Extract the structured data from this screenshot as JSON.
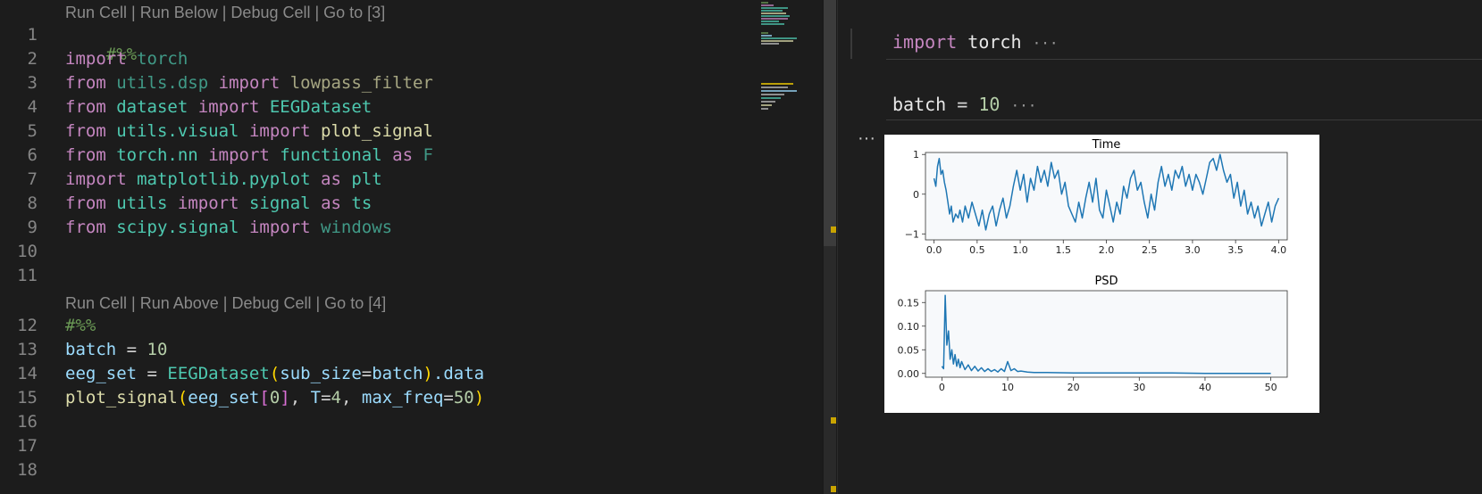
{
  "editor": {
    "lens_cell1": "Run Cell | Run Below | Debug Cell | Go to [3]",
    "lens_cell2": "Run Cell | Run Above | Debug Cell | Go to [4]",
    "line_numbers": [
      "1",
      "2",
      "3",
      "4",
      "5",
      "6",
      "7",
      "8",
      "9",
      "10",
      "11",
      "12",
      "13",
      "14",
      "15",
      "16",
      "17",
      "18"
    ],
    "tok": {
      "l1_marker": "#%%",
      "l2_import": "import",
      "l2_mod": "torch",
      "l3_from": "from",
      "l3_mod": "utils.dsp",
      "l3_import": "import",
      "l3_name": "lowpass_filter",
      "l4_from": "from",
      "l4_mod": "dataset",
      "l4_import": "import",
      "l4_name": "EEGDataset",
      "l5_from": "from",
      "l5_mod": "utils.visual",
      "l5_import": "import",
      "l5_name": "plot_signal",
      "l6_from": "from",
      "l6_mod": "torch.nn",
      "l6_import": "import",
      "l6_name": "functional",
      "l6_as": "as",
      "l6_alias": "F",
      "l7_import": "import",
      "l7_mod": "matplotlib.pyplot",
      "l7_as": "as",
      "l7_alias": "plt",
      "l8_from": "from",
      "l8_mod": "utils",
      "l8_import": "import",
      "l8_name": "signal",
      "l8_as": "as",
      "l8_alias": "ts",
      "l9_from": "from",
      "l9_mod": "scipy.signal",
      "l9_import": "import",
      "l9_name": "windows",
      "l12_marker": "#%%",
      "l13_var": "batch",
      "l13_eq": " = ",
      "l13_num": "10",
      "l14_var": "eeg_set",
      "l14_eq": " = ",
      "l14_cls": "EEGDataset",
      "l14_p": "(",
      "l14_arg": "sub_size",
      "l14_eq2": "=",
      "l14_arg2": "batch",
      "l14_p2": ")",
      "l14_attr": ".data",
      "l15_fn": "plot_signal",
      "l15_p": "(",
      "l15_a": "eeg_set",
      "l15_b": "[",
      "l15_idx": "0",
      "l15_b2": "]",
      "l15_c": ", ",
      "l15_T": "T",
      "l15_eq": "=",
      "l15_Tv": "4",
      "l15_c2": ", ",
      "l15_mf": "max_freq",
      "l15_eq2": "=",
      "l15_mfv": "50",
      "l15_p2": ")"
    }
  },
  "interactive": {
    "cell1_kw": "import",
    "cell1_mod": "torch",
    "cell2_var": "batch",
    "cell2_eq": " = ",
    "cell2_num": "10",
    "collapse_ellipsis": "···",
    "output_more": "···"
  },
  "chart_data": [
    {
      "type": "line",
      "title": "Time",
      "xlabel": "",
      "ylabel": "",
      "xlim": [
        -0.1,
        4.1
      ],
      "ylim": [
        -1.15,
        1.05
      ],
      "xticks": [
        "0.0",
        "0.5",
        "1.0",
        "1.5",
        "2.0",
        "2.5",
        "3.0",
        "3.5",
        "4.0"
      ],
      "yticks": [
        "1",
        "0",
        "−1"
      ],
      "color": "#1f77b4",
      "x": [
        0.0,
        0.02,
        0.04,
        0.06,
        0.08,
        0.1,
        0.12,
        0.14,
        0.16,
        0.18,
        0.2,
        0.22,
        0.25,
        0.28,
        0.3,
        0.33,
        0.36,
        0.4,
        0.44,
        0.48,
        0.52,
        0.56,
        0.6,
        0.64,
        0.68,
        0.72,
        0.76,
        0.8,
        0.84,
        0.88,
        0.92,
        0.96,
        1.0,
        1.04,
        1.08,
        1.12,
        1.16,
        1.2,
        1.24,
        1.28,
        1.32,
        1.36,
        1.4,
        1.44,
        1.48,
        1.52,
        1.56,
        1.6,
        1.64,
        1.68,
        1.72,
        1.76,
        1.8,
        1.84,
        1.88,
        1.92,
        1.96,
        2.0,
        2.04,
        2.08,
        2.12,
        2.16,
        2.2,
        2.24,
        2.28,
        2.32,
        2.36,
        2.4,
        2.44,
        2.48,
        2.52,
        2.56,
        2.6,
        2.64,
        2.68,
        2.72,
        2.76,
        2.8,
        2.84,
        2.88,
        2.92,
        2.96,
        3.0,
        3.04,
        3.08,
        3.12,
        3.16,
        3.2,
        3.24,
        3.28,
        3.32,
        3.36,
        3.4,
        3.44,
        3.48,
        3.52,
        3.56,
        3.6,
        3.64,
        3.68,
        3.72,
        3.76,
        3.8,
        3.84,
        3.88,
        3.92,
        3.96,
        4.0
      ],
      "y": [
        0.4,
        0.2,
        0.7,
        0.9,
        0.5,
        0.6,
        0.3,
        0.1,
        -0.2,
        -0.5,
        -0.3,
        -0.7,
        -0.5,
        -0.6,
        -0.4,
        -0.7,
        -0.3,
        -0.6,
        -0.2,
        -0.5,
        -0.8,
        -0.4,
        -0.9,
        -0.5,
        -0.3,
        -0.8,
        -0.4,
        -0.1,
        -0.6,
        -0.3,
        0.2,
        0.6,
        0.1,
        0.5,
        -0.2,
        0.4,
        0.1,
        0.7,
        0.3,
        0.6,
        0.2,
        0.8,
        0.4,
        0.6,
        0.0,
        0.3,
        -0.3,
        -0.5,
        -0.7,
        -0.2,
        -0.6,
        -0.1,
        0.3,
        -0.2,
        0.4,
        -0.4,
        -0.6,
        0.1,
        -0.3,
        -0.7,
        -0.2,
        -0.5,
        0.2,
        -0.1,
        0.4,
        0.6,
        0.1,
        0.3,
        -0.2,
        -0.6,
        0.0,
        -0.4,
        0.3,
        0.7,
        0.2,
        0.5,
        0.1,
        0.6,
        0.4,
        0.7,
        0.2,
        0.5,
        0.1,
        0.5,
        0.3,
        0.0,
        0.4,
        0.8,
        0.9,
        0.6,
        1.0,
        0.6,
        0.3,
        0.5,
        -0.1,
        0.3,
        -0.3,
        0.1,
        -0.5,
        -0.2,
        -0.6,
        -0.3,
        -0.8,
        -0.5,
        -0.2,
        -0.7,
        -0.3,
        -0.1
      ],
      "grid": false
    },
    {
      "type": "line",
      "title": "PSD",
      "xlabel": "",
      "ylabel": "",
      "xlim": [
        -2.5,
        52.5
      ],
      "ylim": [
        -0.008,
        0.175
      ],
      "xticks": [
        "0",
        "10",
        "20",
        "30",
        "40",
        "50"
      ],
      "yticks": [
        "0.15",
        "0.10",
        "0.05",
        "0.00"
      ],
      "color": "#1f77b4",
      "x": [
        0,
        0.25,
        0.5,
        0.75,
        1.0,
        1.25,
        1.5,
        1.75,
        2.0,
        2.25,
        2.5,
        2.75,
        3.0,
        3.5,
        4.0,
        4.5,
        5.0,
        5.5,
        6.0,
        6.5,
        7.0,
        7.5,
        8.0,
        8.5,
        9.0,
        9.5,
        10.0,
        10.5,
        11.0,
        11.5,
        12.0,
        13.0,
        14.0,
        16.0,
        20.0,
        25.0,
        30.0,
        35.0,
        40.0,
        45.0,
        50.0
      ],
      "y": [
        0.015,
        0.01,
        0.165,
        0.06,
        0.09,
        0.03,
        0.05,
        0.02,
        0.04,
        0.015,
        0.03,
        0.012,
        0.025,
        0.008,
        0.018,
        0.006,
        0.015,
        0.005,
        0.012,
        0.004,
        0.01,
        0.004,
        0.008,
        0.003,
        0.01,
        0.004,
        0.025,
        0.006,
        0.01,
        0.004,
        0.005,
        0.003,
        0.002,
        0.002,
        0.001,
        0.001,
        0.001,
        0.001,
        0.0,
        0.0,
        0.0
      ],
      "grid": false
    }
  ]
}
